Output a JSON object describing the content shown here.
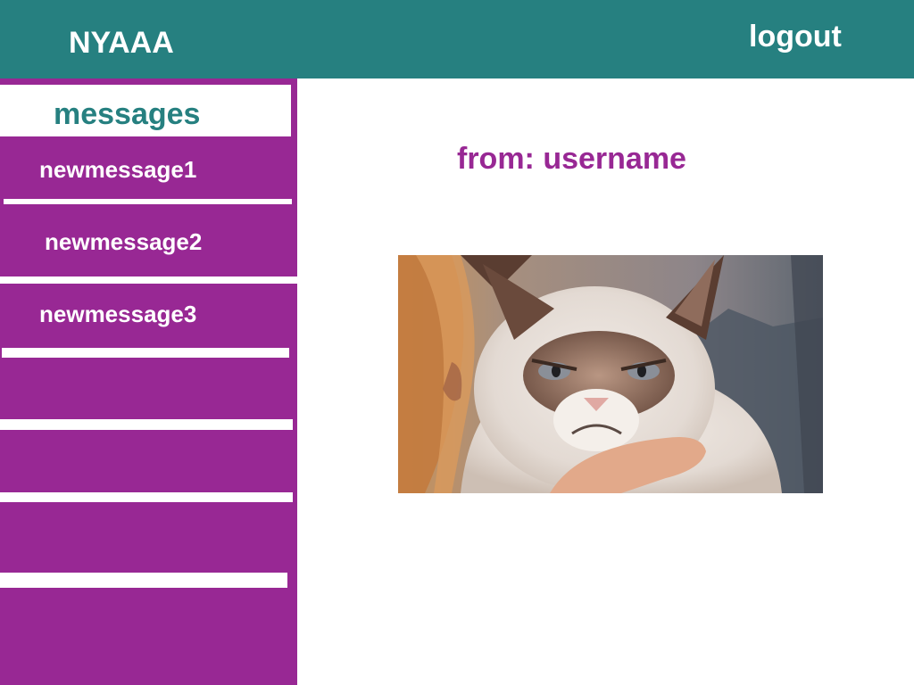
{
  "header": {
    "app_title": "NYAAA",
    "logout_label": "logout"
  },
  "sidebar": {
    "title": "messages",
    "items": [
      {
        "label": "newmessage1"
      },
      {
        "label": "newmessage2"
      },
      {
        "label": "newmessage3"
      }
    ]
  },
  "message": {
    "from_label": "from: username",
    "image_subject": "grumpy-cat-photo"
  },
  "colors": {
    "header_bg": "#268080",
    "sidebar_bg": "#982894",
    "accent_text": "#982894",
    "sidebar_title": "#268080"
  }
}
